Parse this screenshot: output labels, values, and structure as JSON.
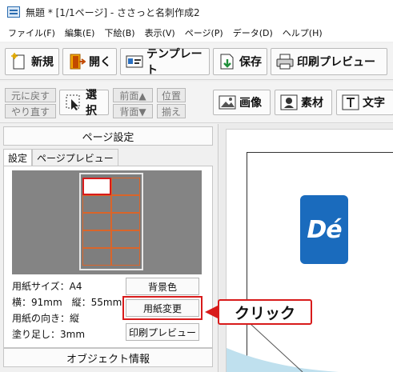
{
  "window": {
    "title": "無題 * [1/1ページ] - ささっと名刺作成2"
  },
  "menu": [
    "ファイル(F)",
    "編集(E)",
    "下絵(B)",
    "表示(V)",
    "ページ(P)",
    "データ(D)",
    "ヘルプ(H)"
  ],
  "toolbar": {
    "new": "新規",
    "open": "開く",
    "template": "テンプレート",
    "save": "保存",
    "print_preview": "印刷プレビュー"
  },
  "toolbar2": {
    "undo": "元に戻す",
    "redo": "やり直す",
    "select": "選択",
    "front": "前面▲",
    "back": "背面▼",
    "pos1": "位置",
    "pos2": "揃え",
    "image": "画像",
    "material": "素材",
    "text": "文字"
  },
  "panel": {
    "title": "ページ設定",
    "tabs": [
      "設定",
      "ページプレビュー"
    ],
    "paper_size": "用紙サイズ：A4",
    "dimensions": "横：91mm　縦：55mm",
    "orientation": "用紙の向き：縦",
    "bleed": "塗り足し：3mm",
    "bg_color_button": "背景色",
    "change_paper_button": "用紙変更",
    "print_preview_button": "印刷プレビュー",
    "object_info": "オブジェクト情報"
  },
  "callout": {
    "label": "クリック"
  },
  "canvas": {
    "logo_text": "Dé"
  },
  "colors": {
    "accent": "#d81b1b",
    "logo": "#1a6bbd",
    "grid": "#d9652a"
  }
}
